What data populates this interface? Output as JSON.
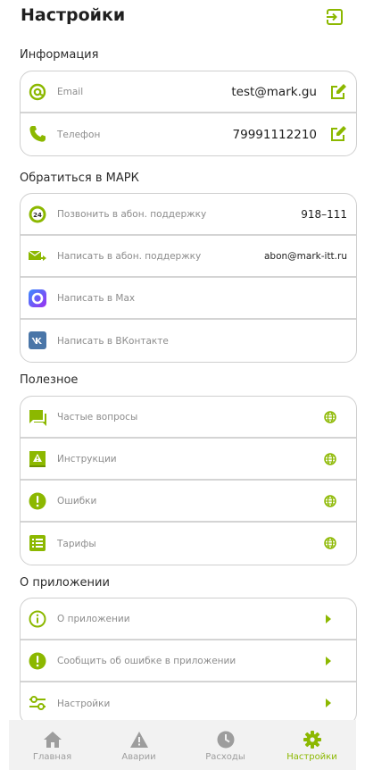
{
  "header": {
    "title": "Настройки"
  },
  "sections": {
    "info": {
      "title": "Информация",
      "items": [
        {
          "label": "Email",
          "value": "test@mark.gu"
        },
        {
          "label": "Телефон",
          "value": "79991112210"
        }
      ]
    },
    "contact": {
      "title": "Обратиться в МАРК",
      "items": [
        {
          "label": "Позвонить в абон. поддержку",
          "value": "918–111"
        },
        {
          "label": "Написать в абон. поддержку",
          "value": "abon@mark-itt.ru"
        },
        {
          "label": "Написать в Max",
          "value": ""
        },
        {
          "label": "Написать в ВКонтакте",
          "value": ""
        }
      ]
    },
    "useful": {
      "title": "Полезное",
      "items": [
        {
          "label": "Частые вопросы"
        },
        {
          "label": "Инструкции"
        },
        {
          "label": "Ошибки"
        },
        {
          "label": "Тарифы"
        }
      ]
    },
    "about": {
      "title": "О приложении",
      "items": [
        {
          "label": "О приложении"
        },
        {
          "label": "Сообщить об ошибке в приложении"
        },
        {
          "label": "Настройки"
        }
      ]
    }
  },
  "tabs": [
    {
      "label": "Главная",
      "icon": "home-icon"
    },
    {
      "label": "Аварии",
      "icon": "warning-icon"
    },
    {
      "label": "Расходы",
      "icon": "clock-icon"
    },
    {
      "label": "Настройки",
      "icon": "gear-icon",
      "active": true
    }
  ],
  "colors": {
    "accent": "#8cb800",
    "muted": "#9d9d9d",
    "divider": "#d4d4d4"
  }
}
